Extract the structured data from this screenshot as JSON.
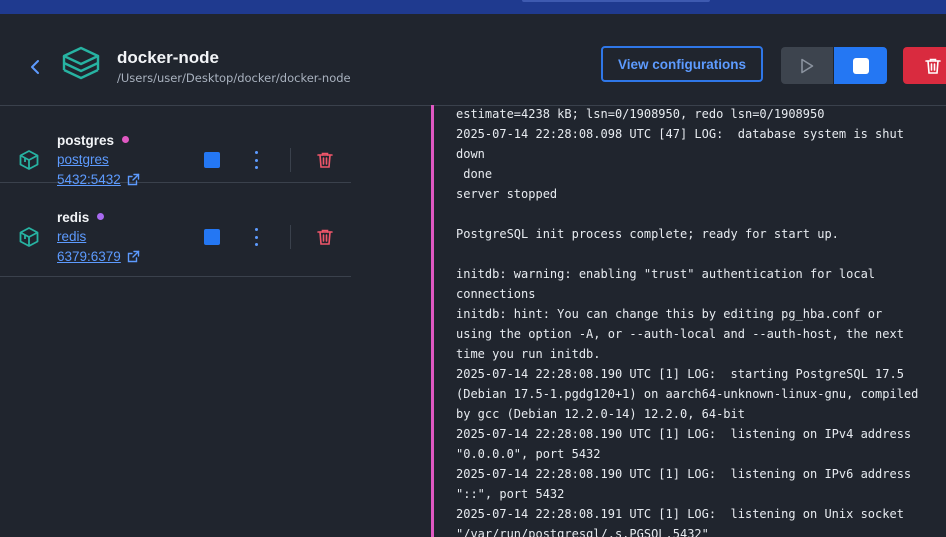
{
  "project": {
    "title": "docker-node",
    "path": "/Users/user/Desktop/docker/docker-node"
  },
  "actions": {
    "view_config": "View configurations"
  },
  "colors": {
    "accent": "#2477f3",
    "danger": "#d92b3f",
    "log_border": "#e058c2"
  },
  "services": [
    {
      "name": "postgres",
      "image": "postgres",
      "ports": "5432:5432",
      "dot_color": "#e058c2"
    },
    {
      "name": "redis",
      "image": "redis",
      "ports": "6379:6379",
      "dot_color": "#a86af0"
    }
  ],
  "logs": [
    "estimate=4238 kB; lsn=0/1908950, redo lsn=0/1908950",
    "2025-07-14 22:28:08.098 UTC [47] LOG:  database system is shut",
    "down",
    " done",
    "server stopped",
    "",
    "PostgreSQL init process complete; ready for start up.",
    "",
    "initdb: warning: enabling \"trust\" authentication for local",
    "connections",
    "initdb: hint: You can change this by editing pg_hba.conf or",
    "using the option -A, or --auth-local and --auth-host, the next",
    "time you run initdb.",
    "2025-07-14 22:28:08.190 UTC [1] LOG:  starting PostgreSQL 17.5",
    "(Debian 17.5-1.pgdg120+1) on aarch64-unknown-linux-gnu, compiled",
    "by gcc (Debian 12.2.0-14) 12.2.0, 64-bit",
    "2025-07-14 22:28:08.190 UTC [1] LOG:  listening on IPv4 address",
    "\"0.0.0.0\", port 5432",
    "2025-07-14 22:28:08.190 UTC [1] LOG:  listening on IPv6 address",
    "\"::\", port 5432",
    "2025-07-14 22:28:08.191 UTC [1] LOG:  listening on Unix socket",
    "\"/var/run/postgresql/.s.PGSQL.5432\""
  ]
}
